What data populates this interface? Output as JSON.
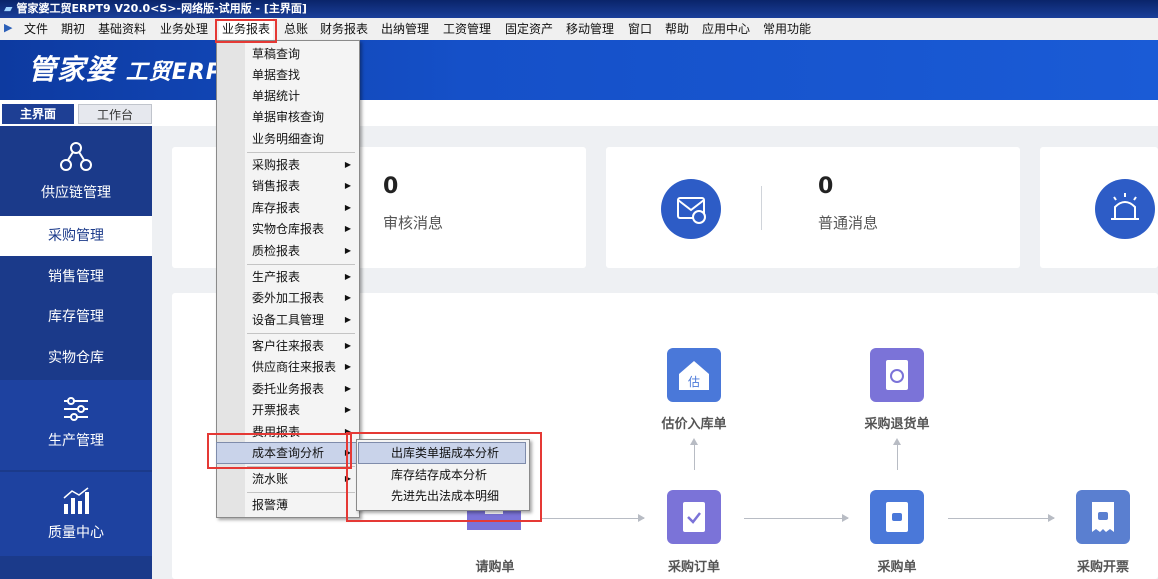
{
  "window": {
    "title": "管家婆工贸ERPT9 V20.0<S>-网络版-试用版 - [主界面]"
  },
  "menubar": {
    "items": [
      "文件",
      "期初",
      "基础资料",
      "业务处理",
      "业务报表",
      "总账",
      "财务报表",
      "出纳管理",
      "工资管理",
      "固定资产",
      "移动管理",
      "窗口",
      "帮助",
      "应用中心",
      "常用功能"
    ],
    "active": "业务报表"
  },
  "brand": {
    "logo_text": "管家婆",
    "logo_sub": "工贸ERP"
  },
  "tabs": {
    "main": "主界面",
    "workbench": "工作台"
  },
  "sidebar": {
    "items": [
      "供应链管理",
      "采购管理",
      "销售管理",
      "库存管理",
      "实物仓库",
      "生产管理",
      "质量中心"
    ],
    "active": "采购管理"
  },
  "stats": [
    {
      "value": "0",
      "label": "审核消息",
      "icon": "mail-check-icon"
    },
    {
      "value": "0",
      "label": "普通消息",
      "icon": "mail-icon"
    },
    {
      "icon": "announcement-icon"
    }
  ],
  "flow": {
    "nodes": [
      "估价入库单",
      "采购退货单",
      "请购单",
      "采购订单",
      "采购单",
      "采购开票"
    ],
    "icon_texts": {
      "estimate": "估"
    }
  },
  "dropdown": {
    "items": [
      {
        "label": "草稿查询",
        "submenu": false
      },
      {
        "label": "单据查找",
        "submenu": false
      },
      {
        "label": "单据统计",
        "submenu": false
      },
      {
        "label": "单据审核查询",
        "submenu": false
      },
      {
        "label": "业务明细查询",
        "submenu": false
      },
      {
        "label": "采购报表",
        "submenu": true
      },
      {
        "label": "销售报表",
        "submenu": true
      },
      {
        "label": "库存报表",
        "submenu": true
      },
      {
        "label": "实物仓库报表",
        "submenu": true
      },
      {
        "label": "质检报表",
        "submenu": true
      },
      {
        "label": "生产报表",
        "submenu": true
      },
      {
        "label": "委外加工报表",
        "submenu": true
      },
      {
        "label": "设备工具管理",
        "submenu": true
      },
      {
        "label": "客户往来报表",
        "submenu": true
      },
      {
        "label": "供应商往来报表",
        "submenu": true
      },
      {
        "label": "委托业务报表",
        "submenu": true
      },
      {
        "label": "开票报表",
        "submenu": true
      },
      {
        "label": "费用报表",
        "submenu": true
      },
      {
        "label": "成本查询分析",
        "submenu": true
      },
      {
        "label": "流水账",
        "submenu": true
      },
      {
        "label": "报警薄",
        "submenu": false
      }
    ],
    "highlighted": "成本查询分析"
  },
  "submenu": {
    "items": [
      "出库类单据成本分析",
      "库存结存成本分析",
      "先进先出法成本明细"
    ],
    "highlighted": "出库类单据成本分析"
  },
  "colors": {
    "accent": "#1b3a8a",
    "highlight_box": "#e53935",
    "icon_blue": "#2d5cc6",
    "icon_purple": "#7b73d8"
  }
}
